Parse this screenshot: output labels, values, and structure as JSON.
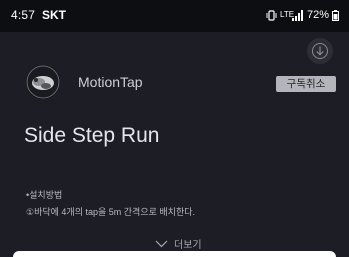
{
  "status_bar": {
    "time": "4:57",
    "carrier": "SKT",
    "network": "LTE",
    "battery": "72%"
  },
  "app": {
    "name": "MotionTap",
    "unsubscribe_label": "구독취소"
  },
  "content": {
    "title": "Side Step Run",
    "install_heading": "•설치방법",
    "install_step": "①바닥에 4개의 tap을 5m 간격으로 배치한다.",
    "more_label": "더보기"
  },
  "icons": {
    "vibrate": "vibrate-icon",
    "network": "network-icon",
    "signal": "signal-icon",
    "battery": "battery-icon",
    "download": "download-icon",
    "expand": "chevron-down-icon"
  },
  "colors": {
    "background": "#1c1d25",
    "status_bar": "#0d0e12",
    "unsubscribe_bg": "#b4b5ba",
    "sheet": "#ffffff"
  }
}
